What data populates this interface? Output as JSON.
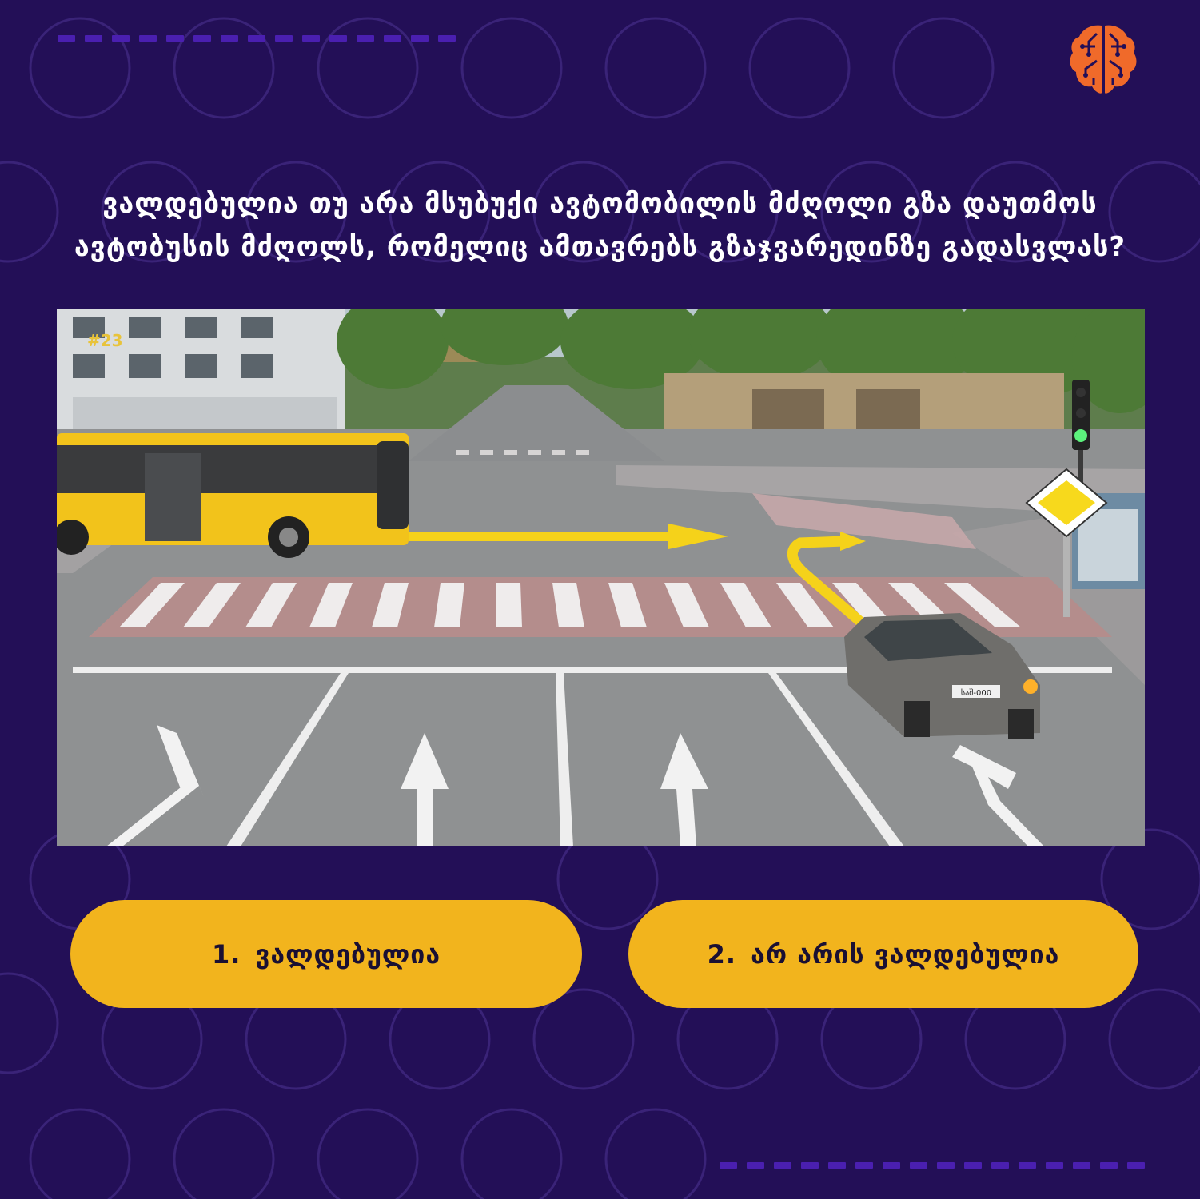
{
  "question": {
    "line1": "ვალდებულია თუ არა მსუბუქი ავტომობილის მძღოლი გზა დაუთმოს",
    "line2": "ავტობუსის მძღოლს, რომელიც ამთავრებს გზაჯვარედინზე გადასვლას?"
  },
  "scene": {
    "sticker_text": "#23",
    "plate_text": "საშ-000"
  },
  "answers": [
    {
      "number": "1.",
      "label": "ვალდებულია"
    },
    {
      "number": "2.",
      "label": "არ არის ვალდებულია"
    }
  ],
  "colors": {
    "background": "#230f57",
    "answer_bg": "#f2b41d",
    "accent_dash": "#4a1fb0",
    "logo": "#f06a2a",
    "route_arrow": "#f5d21a"
  },
  "icons": {
    "logo": "brain-circuit-icon",
    "priority_sign": "priority-road-sign-icon",
    "traffic_light": "traffic-light-icon"
  }
}
